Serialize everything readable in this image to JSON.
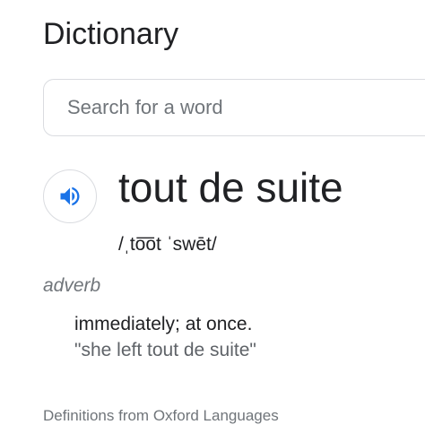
{
  "header": {
    "title": "Dictionary"
  },
  "search": {
    "placeholder": "Search for a word",
    "value": ""
  },
  "entry": {
    "audio_icon": "speaker-icon",
    "headword": "tout de suite",
    "pronunciation": "/ˌto͞ot ˈswēt/",
    "part_of_speech": "adverb",
    "senses": [
      {
        "definition": "immediately; at once.",
        "example": "\"she left tout de suite\""
      }
    ]
  },
  "footer": {
    "source": "Definitions from Oxford Languages"
  },
  "colors": {
    "accent_blue": "#1a73e8",
    "text_primary": "#202124",
    "text_secondary": "#70757a",
    "border": "#dadce0"
  }
}
